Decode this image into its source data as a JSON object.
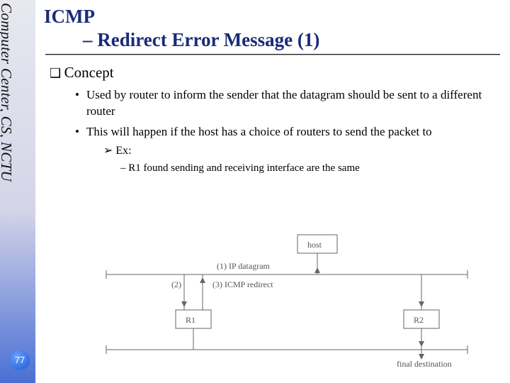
{
  "sidebar": {
    "institution": "Computer Center, CS, NCTU"
  },
  "slide": {
    "number": "77",
    "title_main": "ICMP",
    "title_sub": "– Redirect Error Message (1)"
  },
  "content": {
    "section_head": "Concept",
    "bullets": [
      "Used by router to inform the sender that the datagram should be sent to a different router",
      "This will happen if the host has a choice of routers to send the packet to"
    ],
    "sub1": "Ex:",
    "sub2": "R1 found sending and receiving interface are the same"
  },
  "diagram": {
    "labels": {
      "host": "host",
      "r1": "R1",
      "r2": "R2",
      "final": "final destination",
      "a1": "(1) IP datagram",
      "a2": "(2)",
      "a3": "(3) ICMP redirect"
    }
  }
}
